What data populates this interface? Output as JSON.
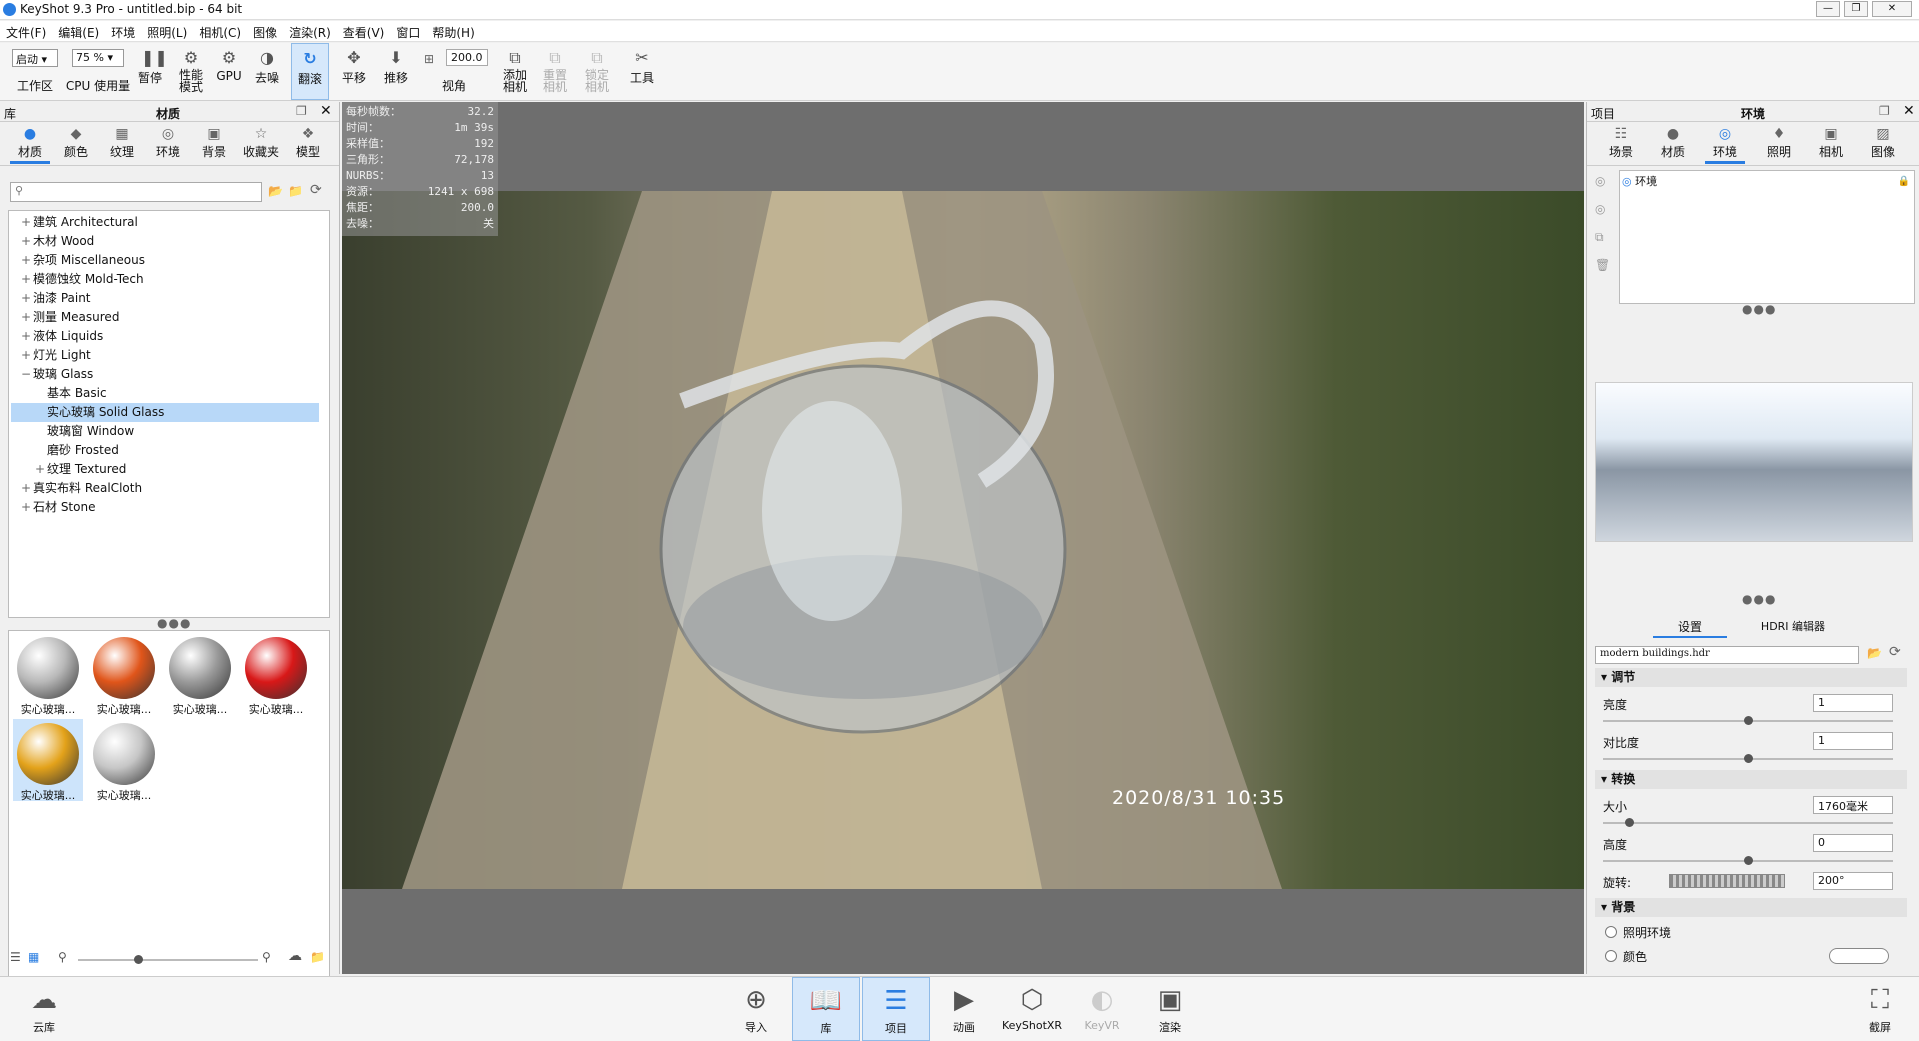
{
  "window": {
    "title": "KeyShot 9.3 Pro  - untitled.bip  - 64 bit",
    "min": "—",
    "max": "❐",
    "close": "✕"
  },
  "menu": [
    "文件(F)",
    "编辑(E)",
    "环境",
    "照明(L)",
    "相机(C)",
    "图像",
    "渲染(R)",
    "查看(V)",
    "窗口",
    "帮助(H)"
  ],
  "toolbar": {
    "workspace_select": "启动",
    "workspace_label": "工作区",
    "cpu_select": "75 %",
    "cpu_label": "CPU 使用量",
    "pause": "暂停",
    "perf": "性能\n模式",
    "gpu": "GPU",
    "denoise": "去噪",
    "tumble": "翻滚",
    "pan": "平移",
    "dolly": "推移",
    "fov_value": "200.0",
    "fov_label": "视角",
    "add_camera": "添加\n相机",
    "reset_camera": "重置\n相机",
    "lock_camera": "锁定\n相机",
    "tools": "工具"
  },
  "left": {
    "lib_label": "库",
    "title": "材质",
    "tabs": [
      "材质",
      "颜色",
      "纹理",
      "环境",
      "背景",
      "收藏夹",
      "模型"
    ],
    "search_placeholder": "",
    "tree": [
      {
        "label": "建筑 Architectural",
        "expander": "+",
        "indent": 0
      },
      {
        "label": "木材 Wood",
        "expander": "+",
        "indent": 0
      },
      {
        "label": "杂项 Miscellaneous",
        "expander": "+",
        "indent": 0
      },
      {
        "label": "模德蚀纹 Mold-Tech",
        "expander": "+",
        "indent": 0
      },
      {
        "label": "油漆 Paint",
        "expander": "+",
        "indent": 0
      },
      {
        "label": "测量 Measured",
        "expander": "+",
        "indent": 0
      },
      {
        "label": "液体 Liquids",
        "expander": "+",
        "indent": 0
      },
      {
        "label": "灯光 Light",
        "expander": "+",
        "indent": 0
      },
      {
        "label": "玻璃 Glass",
        "expander": "−",
        "indent": 0
      },
      {
        "label": "基本 Basic",
        "expander": "",
        "indent": 1
      },
      {
        "label": "实心玻璃 Solid Glass",
        "expander": "",
        "indent": 1
      },
      {
        "label": "玻璃窗 Window",
        "expander": "",
        "indent": 1
      },
      {
        "label": "磨砂 Frosted",
        "expander": "",
        "indent": 1
      },
      {
        "label": "纹理 Textured",
        "expander": "+",
        "indent": 1
      },
      {
        "label": "真实布料 RealCloth",
        "expander": "+",
        "indent": 0
      },
      {
        "label": "石材 Stone",
        "expander": "+",
        "indent": 0
      }
    ],
    "selected_tree_index": 10,
    "thumbs": [
      {
        "label": "实心玻璃...",
        "color": "#b8b8b8"
      },
      {
        "label": "实心玻璃...",
        "color": "#e0551a"
      },
      {
        "label": "实心玻璃...",
        "color": "#9a9a9a"
      },
      {
        "label": "实心玻璃...",
        "color": "#d81818"
      },
      {
        "label": "实心玻璃...",
        "color": "#e3a21a"
      },
      {
        "label": "实心玻璃...",
        "color": "#c6c6c6"
      }
    ],
    "selected_thumb": 4
  },
  "stats": [
    {
      "k": "每秒帧数：",
      "v": "32.2"
    },
    {
      "k": "时间：",
      "v": "1m 39s"
    },
    {
      "k": "采样值：",
      "v": "192"
    },
    {
      "k": "三角形：",
      "v": "72,178"
    },
    {
      "k": "NURBS：",
      "v": "13"
    },
    {
      "k": "资源：",
      "v": "1241 x 698"
    },
    {
      "k": "焦距：",
      "v": "200.0"
    },
    {
      "k": "去噪：",
      "v": "关"
    }
  ],
  "viewport": {
    "timestamp": "2020/8/31  10:35"
  },
  "right": {
    "project_label": "项目",
    "title": "环境",
    "tabs": [
      "场景",
      "材质",
      "环境",
      "照明",
      "相机",
      "图像"
    ],
    "env_item": "环境",
    "subtabs": [
      "设置",
      "HDRI 编辑器"
    ],
    "hdr_file": "modern buildings.hdr",
    "sections": {
      "adjust": "调节",
      "transform": "转换",
      "background": "背景"
    },
    "brightness_label": "亮度",
    "brightness_value": "1",
    "brightness_pos": 0.5,
    "contrast_label": "对比度",
    "contrast_value": "1",
    "contrast_pos": 0.5,
    "size_label": "大小",
    "size_value": "1760毫米",
    "size_pos": 0.08,
    "height_label": "高度",
    "height_value": "0",
    "height_pos": 0.5,
    "rotation_label": "旋转:",
    "rotation_value": "200°",
    "bg_opt1": "照明环境",
    "bg_opt2": "颜色"
  },
  "bottom": {
    "cloud": "云库",
    "import": "导入",
    "library": "库",
    "project": "项目",
    "animation": "动画",
    "keyshotxr": "KeyShotXR",
    "keyvr": "KeyVR",
    "render": "渲染",
    "screenshot": "截屏"
  },
  "colors": {
    "accent": "#2a7de1",
    "active_bg": "#d6e8fb",
    "selected_row": "#b8d8f8"
  }
}
